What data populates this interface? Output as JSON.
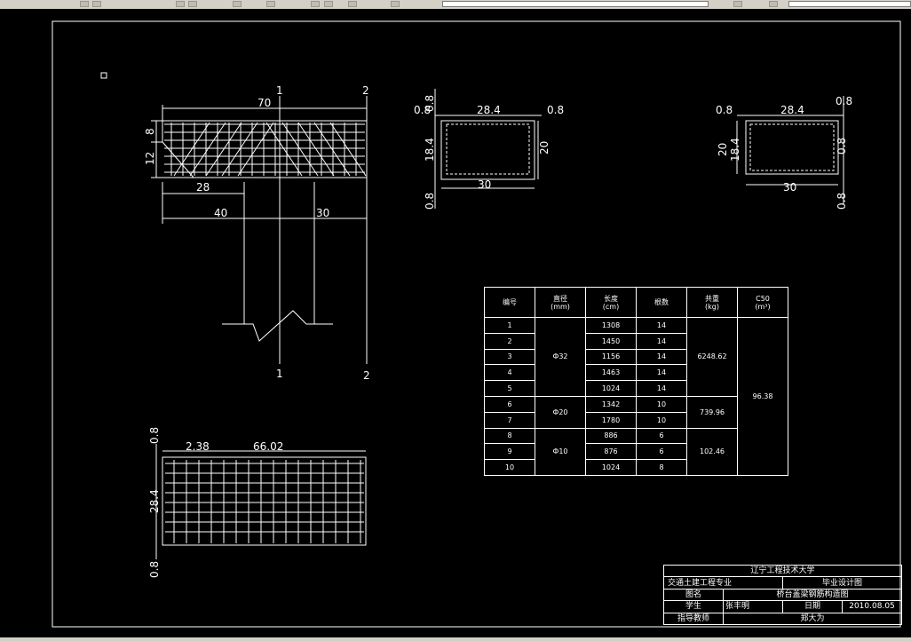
{
  "toolbar": {
    "description": "CAD application toolbar (partially visible)"
  },
  "drawing": {
    "section_marks": {
      "one": "1",
      "two": "2"
    },
    "elev": {
      "dim_top": "70",
      "dim_left_top": "8",
      "dim_left_bottom": "12",
      "dim_28": "28",
      "dim_40": "40",
      "dim_30": "30"
    },
    "sec1": {
      "top_left": "0.8",
      "top_mid": "28.4",
      "top_right": "0.8",
      "left_upper": "0.8",
      "left_mid": "18.4",
      "right": "20",
      "bottom": "30",
      "left_lower": "0.8"
    },
    "sec2": {
      "top_left": "0.8",
      "top_mid": "28.4",
      "top_right": "0.8",
      "left_a": "20",
      "left_b": "18.4",
      "right_upper": "0.8",
      "right_lower": "0.8",
      "bottom": "30"
    },
    "plan": {
      "top_left": "2.38",
      "top_mid": "66.02",
      "left_upper": "0.8",
      "left_mid": "28.4",
      "left_lower": "0.8"
    }
  },
  "schedule": {
    "headers": [
      "编号",
      "直径\n(mm)",
      "长度\n(cm)",
      "根数",
      "共重\n(kg)",
      "C50\n(m³)"
    ],
    "rows": [
      {
        "no": "1",
        "len": "1308",
        "count": "14"
      },
      {
        "no": "2",
        "len": "1450",
        "count": "14"
      },
      {
        "no": "3",
        "len": "1156",
        "count": "14"
      },
      {
        "no": "4",
        "len": "1463",
        "count": "14"
      },
      {
        "no": "5",
        "len": "1024",
        "count": "14"
      },
      {
        "no": "6",
        "len": "1342",
        "count": "10"
      },
      {
        "no": "7",
        "len": "1780",
        "count": "10"
      },
      {
        "no": "8",
        "len": "886",
        "count": "6"
      },
      {
        "no": "9",
        "len": "876",
        "count": "6"
      },
      {
        "no": "10",
        "len": "1024",
        "count": "8"
      }
    ],
    "diameters": [
      "Ф32",
      "Ф20",
      "Ф10"
    ],
    "weights": [
      "6248.62",
      "739.96",
      "102.46"
    ],
    "concrete": "96.38"
  },
  "title_block": {
    "school": "辽宁工程技术大学",
    "major": "交通土建工程专业",
    "project": "毕业设计图",
    "name_label": "图名",
    "name_value": "桥台盖梁钢筋构造图",
    "student_label": "学生",
    "student_value": "张丰明",
    "date_label": "日期",
    "date_value": "2010.08.05",
    "advisor_label": "指导教师",
    "advisor_value": "郑大为"
  }
}
